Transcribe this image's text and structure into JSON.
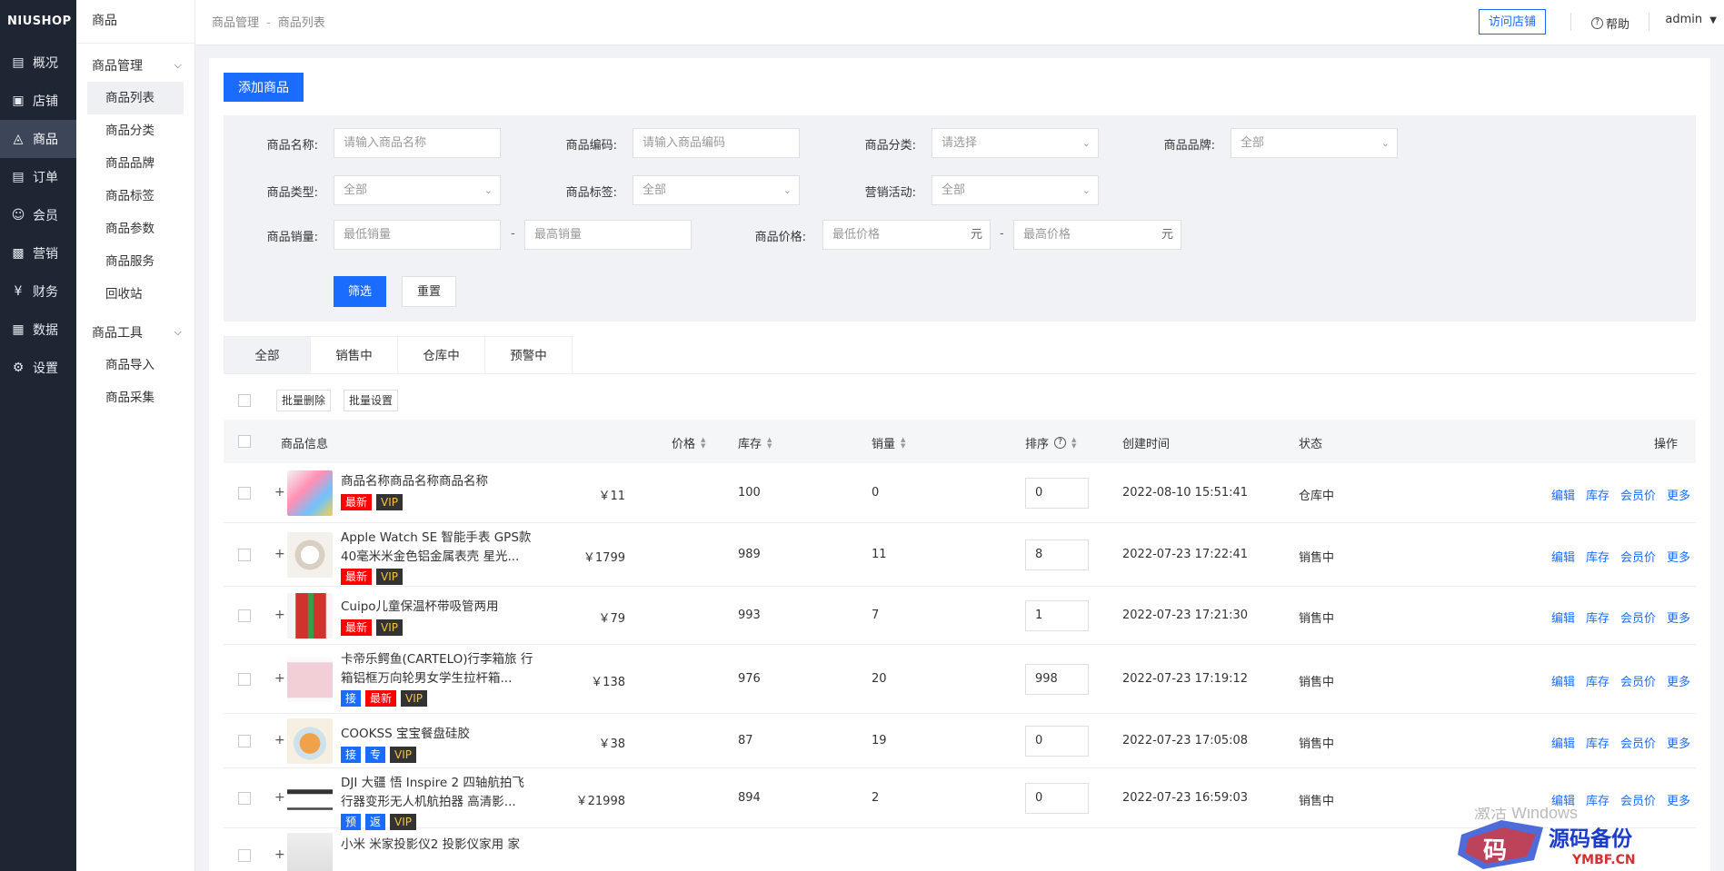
{
  "brand": "NIUSHOP",
  "nav": [
    {
      "label": "概况",
      "icon": "overview-icon"
    },
    {
      "label": "店铺",
      "icon": "store-icon"
    },
    {
      "label": "商品",
      "icon": "goods-icon",
      "active": true
    },
    {
      "label": "订单",
      "icon": "order-icon"
    },
    {
      "label": "会员",
      "icon": "member-icon"
    },
    {
      "label": "营销",
      "icon": "marketing-icon"
    },
    {
      "label": "财务",
      "icon": "finance-icon"
    },
    {
      "label": "数据",
      "icon": "data-icon"
    },
    {
      "label": "设置",
      "icon": "settings-icon"
    }
  ],
  "subnav": {
    "title": "商品",
    "group1": "商品管理",
    "group1_items": [
      "商品列表",
      "商品分类",
      "商品品牌",
      "商品标签",
      "商品参数",
      "商品服务",
      "回收站"
    ],
    "group2": "商品工具",
    "group2_items": [
      "商品导入",
      "商品采集"
    ]
  },
  "topbar": {
    "crumb1": "商品管理",
    "crumb_sep": "-",
    "crumb2": "商品列表",
    "visit_store": "访问店铺",
    "help": "帮助",
    "user": "admin"
  },
  "add_button": "添加商品",
  "filter": {
    "name_label": "商品名称:",
    "name_placeholder": "请输入商品名称",
    "code_label": "商品编码:",
    "code_placeholder": "请输入商品编码",
    "category_label": "商品分类:",
    "category_value": "请选择",
    "brand_label": "商品品牌:",
    "brand_value": "全部",
    "type_label": "商品类型:",
    "type_value": "全部",
    "tag_label": "商品标签:",
    "tag_value": "全部",
    "promo_label": "营销活动:",
    "promo_value": "全部",
    "sales_label": "商品销量:",
    "sales_min": "最低销量",
    "sales_max": "最高销量",
    "price_label": "商品价格:",
    "price_min": "最低价格",
    "price_max": "最高价格",
    "unit": "元",
    "dash": "-",
    "filter_btn": "筛选",
    "reset_btn": "重置"
  },
  "tabs": [
    "全部",
    "销售中",
    "仓库中",
    "预警中"
  ],
  "batch": {
    "delete": "批量删除",
    "set": "批量设置"
  },
  "columns": {
    "info": "商品信息",
    "price": "价格",
    "stock": "库存",
    "sales": "销量",
    "sort": "排序",
    "created": "创建时间",
    "status": "状态",
    "ops": "操作"
  },
  "ops_labels": [
    "编辑",
    "库存",
    "会员价",
    "更多"
  ],
  "rows": [
    {
      "name": "商品名称商品名称商品名称",
      "tags": [
        "最新",
        "VIP"
      ],
      "price": "￥11",
      "stock": "100",
      "sales": "0",
      "sort": "0",
      "created": "2022-08-10 15:51:41",
      "status": "仓库中"
    },
    {
      "name": "Apple Watch SE 智能手表 GPS款 40毫米米金色铝金属表壳 星光...",
      "tags": [
        "最新",
        "VIP"
      ],
      "price": "￥1799",
      "stock": "989",
      "sales": "11",
      "sort": "8",
      "created": "2022-07-23 17:22:41",
      "status": "销售中"
    },
    {
      "name": "Cuipo儿童保温杯带吸管两用",
      "tags": [
        "最新",
        "VIP"
      ],
      "price": "￥79",
      "stock": "993",
      "sales": "7",
      "sort": "1",
      "created": "2022-07-23 17:21:30",
      "status": "销售中"
    },
    {
      "name": "卡帝乐鳄鱼(CARTELO)行李箱旅 行箱铝框万向轮男女学生拉杆箱...",
      "tags": [
        "接",
        "最新",
        "VIP"
      ],
      "price": "￥138",
      "stock": "976",
      "sales": "20",
      "sort": "998",
      "created": "2022-07-23 17:19:12",
      "status": "销售中"
    },
    {
      "name": "COOKSS 宝宝餐盘硅胶",
      "tags": [
        "接",
        "专",
        "VIP"
      ],
      "price": "￥38",
      "stock": "87",
      "sales": "19",
      "sort": "0",
      "created": "2022-07-23 17:05:08",
      "status": "销售中"
    },
    {
      "name": "DJI 大疆 悟 Inspire 2 四轴航拍飞 行器变形无人机航拍器 高清影...",
      "tags": [
        "预",
        "返",
        "VIP"
      ],
      "price": "￥21998",
      "stock": "894",
      "sales": "2",
      "sort": "0",
      "created": "2022-07-23 16:59:03",
      "status": "销售中"
    },
    {
      "name": "小米 米家投影仪2 投影仪家用 家",
      "tags": [],
      "price": "",
      "stock": "",
      "sales": "",
      "sort": "",
      "created": "",
      "status": ""
    }
  ],
  "watermark": {
    "cn": "源码备份",
    "en": "YMBF.CN",
    "glyph": "码",
    "activate": "激活 Windows"
  }
}
